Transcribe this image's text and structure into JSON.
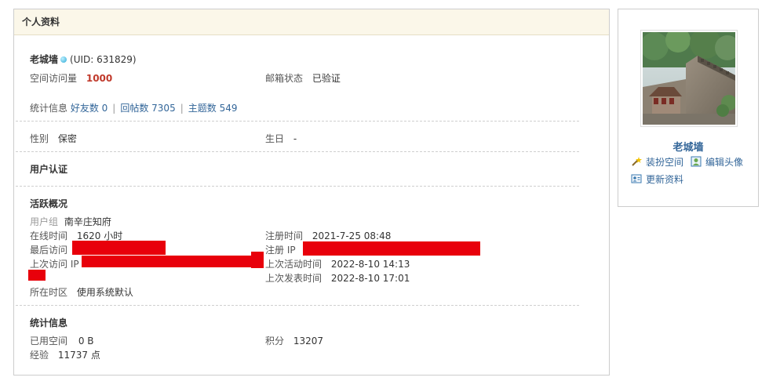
{
  "panel": {
    "title": "个人资料"
  },
  "profile": {
    "username": "老城墙",
    "uid": "(UID: 631829)",
    "visits_label": "空间访问量",
    "visits_value": "1000",
    "email_label": "邮箱状态",
    "email_value": "已验证"
  },
  "stats_line": {
    "label": "统计信息",
    "friends": "好友数 0",
    "replies": "回帖数 7305",
    "threads": "主题数 549"
  },
  "basic": {
    "gender_label": "性别",
    "gender_value": "保密",
    "birthday_label": "生日",
    "birthday_value": "-"
  },
  "auth": {
    "title": "用户认证"
  },
  "activity": {
    "title": "活跃概况",
    "group_label": "用户组",
    "group_value": "南辛庄知府",
    "online_label": "在线时间",
    "online_value": "1620 小时",
    "register_label": "注册时间",
    "register_value": "2021-7-25 08:48",
    "last_visit_label": "最后访问",
    "register_ip_label": "注册 IP",
    "last_ip_label": "上次访问 IP",
    "last_active_label": "上次活动时间",
    "last_active_value": "2022-8-10 14:13",
    "last_post_label": "上次发表时间",
    "last_post_value": "2022-8-10 17:01",
    "timezone_label": "所在时区",
    "timezone_value": "使用系统默认"
  },
  "statistics": {
    "title": "统计信息",
    "space_label": "已用空间",
    "space_value": "0 B",
    "points_label": "积分",
    "points_value": "13207",
    "exp_label": "经验",
    "exp_value": "11737 点"
  },
  "sidebar": {
    "name": "老城墙",
    "decorate": "装扮空间",
    "edit_avatar": "编辑头像",
    "update_profile": "更新资料"
  },
  "colors": {
    "header_bg": "#fbf7e9",
    "link": "#336699",
    "visits": "#c0392b",
    "redaction": "#e8000b"
  }
}
